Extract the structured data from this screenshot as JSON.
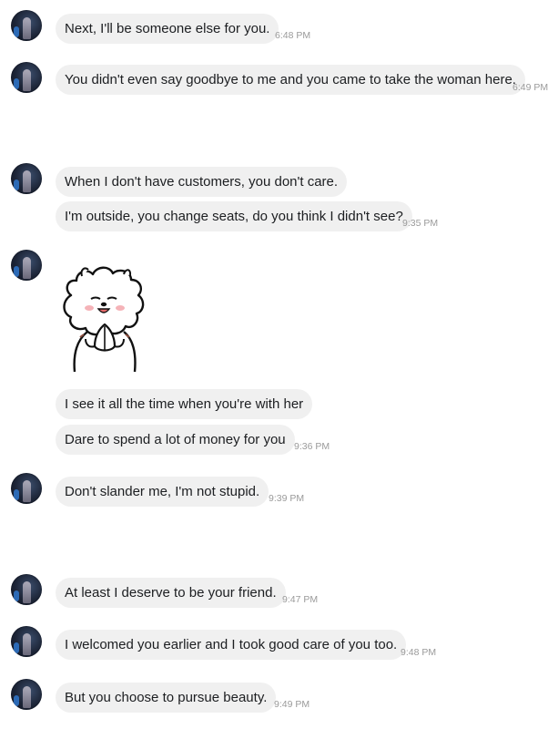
{
  "messages": [
    {
      "text": "Next, I'll be someone else for you.",
      "time": "6:48 PM"
    },
    {
      "text": "You didn't even say goodbye to me and you came to take the woman here.",
      "time": "6:49 PM"
    },
    {
      "text": "When I don't have customers, you don't care.",
      "time": ""
    },
    {
      "text": "I'm outside, you change seats, do you think I didn't see?",
      "time": "9:35 PM"
    },
    {
      "text": "I see it all the time when you're with her",
      "time": ""
    },
    {
      "text": "Dare to spend a lot of money for you",
      "time": "9:36 PM"
    },
    {
      "text": "Don't slander me, I'm not stupid.",
      "time": "9:39 PM"
    },
    {
      "text": "At least I deserve to be your friend.",
      "time": "9:47 PM"
    },
    {
      "text": "I welcomed you earlier and I took good care of you too.",
      "time": "9:48 PM"
    },
    {
      "text": "But you choose to pursue beauty.",
      "time": "9:49 PM"
    }
  ],
  "sticker": {
    "icon": "sheep-praying-sticker"
  },
  "colors": {
    "bubble": "#f0f0f0",
    "text": "#1c1e21",
    "timestamp": "#9a9a9a"
  }
}
